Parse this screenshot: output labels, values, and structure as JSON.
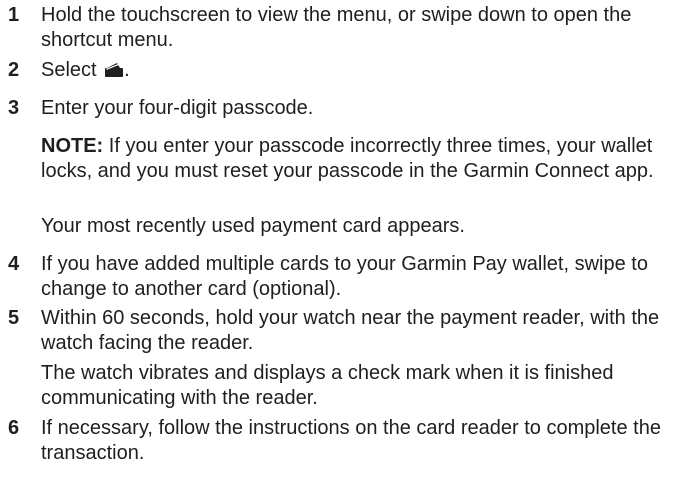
{
  "steps": [
    {
      "number": "1",
      "text": "Hold the touchscreen to view the menu, or swipe down to open the shortcut menu."
    },
    {
      "number": "2",
      "text_before": "Select",
      "icon": "wallet-icon",
      "text_after": "."
    },
    {
      "number": "3",
      "text": "Enter your four-digit passcode.",
      "note_label": "NOTE:",
      "note_text": "If you enter your passcode incorrectly three times, your wallet locks, and you must reset your passcode in the Garmin Connect app.",
      "result": "Your most recently used payment card appears."
    },
    {
      "number": "4",
      "text": "If you have added multiple cards to your Garmin Pay wallet, swipe to change to another card (optional)."
    },
    {
      "number": "5",
      "text": "Within 60 seconds, hold your watch near the payment reader, with the watch facing the reader.",
      "result": "The watch vibrates and displays a check mark when it is finished communicating with the reader."
    },
    {
      "number": "6",
      "text": "If necessary, follow the instructions on the card reader to complete the transaction."
    }
  ]
}
